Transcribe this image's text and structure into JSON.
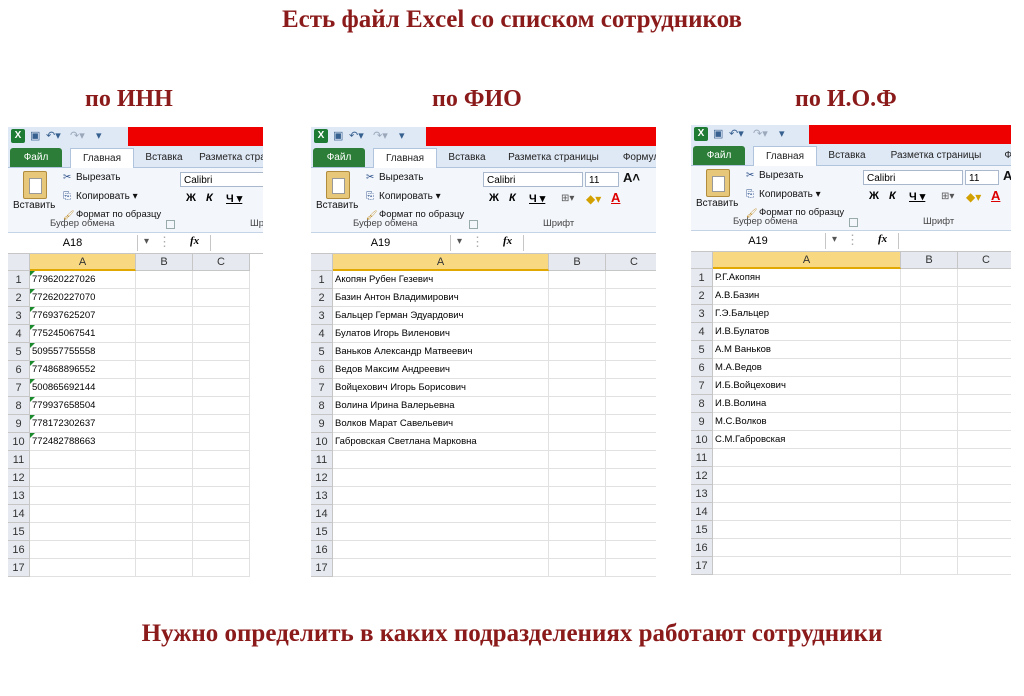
{
  "top_title": "Есть файл Excel со списком сотрудников",
  "bottom_title": "Нужно определить в каких подразделениях работают сотрудники",
  "panels": [
    {
      "caption": "по ИНН",
      "tabs": [
        "Файл",
        "Главная",
        "Вставка",
        "Разметка страни"
      ],
      "clipboard": {
        "paste": "Вставить",
        "cut": "Вырезать",
        "copy": "Копировать ▾",
        "format_painter": "Формат по образцу",
        "group": "Буфер обмена"
      },
      "font": {
        "name": "Calibri",
        "size": "",
        "group": "Шрифт",
        "bold": "Ж",
        "italic": "К",
        "underline": "Ч ▾"
      },
      "name_box": "A18",
      "fx": "fx",
      "columns": [
        "A",
        "B",
        "C"
      ],
      "rows": [
        "1",
        "2",
        "3",
        "4",
        "5",
        "6",
        "7",
        "8",
        "9",
        "10",
        "11",
        "12",
        "13",
        "14",
        "15",
        "16",
        "17"
      ],
      "values": [
        "779620227026",
        "772620227070",
        "776937625207",
        "775245067541",
        "509557755558",
        "774868896552",
        "500865692144",
        "779937658504",
        "778172302637",
        "772482788663"
      ]
    },
    {
      "caption": "по ФИО",
      "tabs": [
        "Файл",
        "Главная",
        "Вставка",
        "Разметка страницы",
        "Формул"
      ],
      "clipboard": {
        "paste": "Вставить",
        "cut": "Вырезать",
        "copy": "Копировать ▾",
        "format_painter": "Формат по образцу",
        "group": "Буфер обмена"
      },
      "font": {
        "name": "Calibri",
        "size": "11",
        "group": "Шрифт",
        "bold": "Ж",
        "italic": "К",
        "underline": "Ч ▾"
      },
      "name_box": "A19",
      "fx": "fx",
      "columns": [
        "A",
        "B",
        "C"
      ],
      "rows": [
        "1",
        "2",
        "3",
        "4",
        "5",
        "6",
        "7",
        "8",
        "9",
        "10",
        "11",
        "12",
        "13",
        "14",
        "15",
        "16",
        "17"
      ],
      "values": [
        "Акопян Рубен Гезевич",
        "Базин Антон Владимирович",
        "Бальцер Герман Эдуардович",
        "Булатов Игорь Виленович",
        "Ваньков Александр Матвеевич",
        "Ведов Максим Андреевич",
        "Войцехович Игорь Борисович",
        "Волина Ирина Валерьевна",
        "Волков Марат Савельевич",
        "Габровская Светлана Марковна"
      ]
    },
    {
      "caption": "по И.О.Ф",
      "tabs": [
        "Файл",
        "Главная",
        "Вставка",
        "Разметка страницы",
        "Фо"
      ],
      "clipboard": {
        "paste": "Вставить",
        "cut": "Вырезать",
        "copy": "Копировать ▾",
        "format_painter": "Формат по образцу",
        "group": "Буфер обмена"
      },
      "font": {
        "name": "Calibri",
        "size": "11",
        "group": "Шрифт",
        "bold": "Ж",
        "italic": "К",
        "underline": "Ч ▾"
      },
      "name_box": "A19",
      "fx": "fx",
      "columns": [
        "A",
        "B",
        "C"
      ],
      "rows": [
        "1",
        "2",
        "3",
        "4",
        "5",
        "6",
        "7",
        "8",
        "9",
        "10",
        "11",
        "12",
        "13",
        "14",
        "15",
        "16",
        "17"
      ],
      "values": [
        "Р.Г.Акопян",
        "А.В.Базин",
        "Г.Э.Бальцер",
        "И.В.Булатов",
        "А.М Ваньков",
        "М.А.Ведов",
        "И.Б.Войцехович",
        "И.В.Волина",
        "М.С.Волков",
        "С.М.Габровская"
      ]
    }
  ],
  "colors": {
    "title": "#8b1a1a",
    "file_tab": "#2c7d37",
    "qat_red": "#ee0000",
    "selected_header": "#f8d881"
  }
}
